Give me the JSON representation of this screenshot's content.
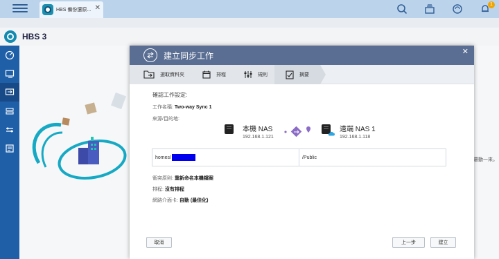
{
  "topbar": {
    "app_tab_label": "HBS 備份還原...",
    "notification_count": "1"
  },
  "app": {
    "title": "HBS 3"
  },
  "background": {
    "right_text": "還動一來。"
  },
  "dialog": {
    "title": "建立同步工作",
    "steps": [
      {
        "label": "選取資料夾"
      },
      {
        "label": "排程"
      },
      {
        "label": "規則"
      },
      {
        "label": "摘要"
      }
    ],
    "section_title": "確認工作設定:",
    "job_name_label": "工作名稱:",
    "job_name_value": "Two-way Sync 1",
    "source_dest_label": "來源/目的地:",
    "local_nas": {
      "name": "本機 NAS",
      "ip": "192.168.1.121"
    },
    "remote_nas": {
      "name": "遠端 NAS 1",
      "ip": "192.168.1.118"
    },
    "local_path": "homes/",
    "remote_path": "/Public",
    "conflict_label": "衝突原則:",
    "conflict_value": "重新命名本機檔案",
    "schedule_label": "排程:",
    "schedule_value": "沒有排程",
    "network_label": "網路介面卡:",
    "network_value": "自動 (最佳化)",
    "buttons": {
      "cancel": "取消",
      "back": "上一步",
      "create": "建立"
    }
  },
  "colors": {
    "header": "#5a6d92",
    "sidebar": "#1f5fa8",
    "topbar": "#bcd3ec",
    "sync_accent": "#8b6cc7"
  }
}
